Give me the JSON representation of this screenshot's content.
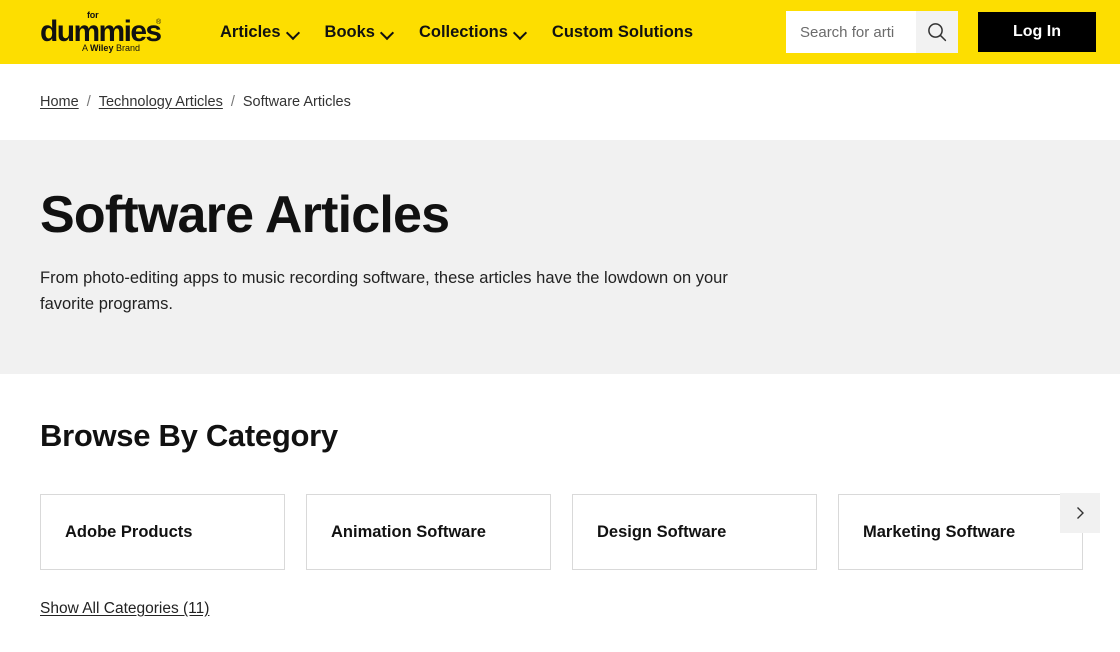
{
  "header": {
    "logo": {
      "for": "for",
      "name": "dummies",
      "registered": "®",
      "tagline_prefix": "A ",
      "tagline_brand": "Wiley",
      "tagline_suffix": " Brand"
    },
    "nav": [
      {
        "label": "Articles",
        "has_dropdown": true
      },
      {
        "label": "Books",
        "has_dropdown": true
      },
      {
        "label": "Collections",
        "has_dropdown": true
      },
      {
        "label": "Custom Solutions",
        "has_dropdown": false
      }
    ],
    "search": {
      "placeholder": "Search for arti",
      "value": "",
      "icon": "search-icon"
    },
    "login_label": "Log In",
    "background_color": "#fdde00"
  },
  "breadcrumb": {
    "separator": "/",
    "items": [
      {
        "label": "Home",
        "is_link": true
      },
      {
        "label": "Technology Articles",
        "is_link": true
      },
      {
        "label": "Software Articles",
        "is_link": false
      }
    ]
  },
  "hero": {
    "title": "Software Articles",
    "description": "From photo-editing apps to music recording software, these articles have the lowdown on your favorite programs.",
    "background_color": "#f1f1f1"
  },
  "browse": {
    "title": "Browse By Category",
    "categories": [
      {
        "label": "Adobe Products"
      },
      {
        "label": "Animation Software"
      },
      {
        "label": "Design Software"
      },
      {
        "label": "Marketing Software"
      }
    ],
    "carousel_next_icon": "chevron-right-icon",
    "show_all_label": "Show All Categories (11)"
  }
}
